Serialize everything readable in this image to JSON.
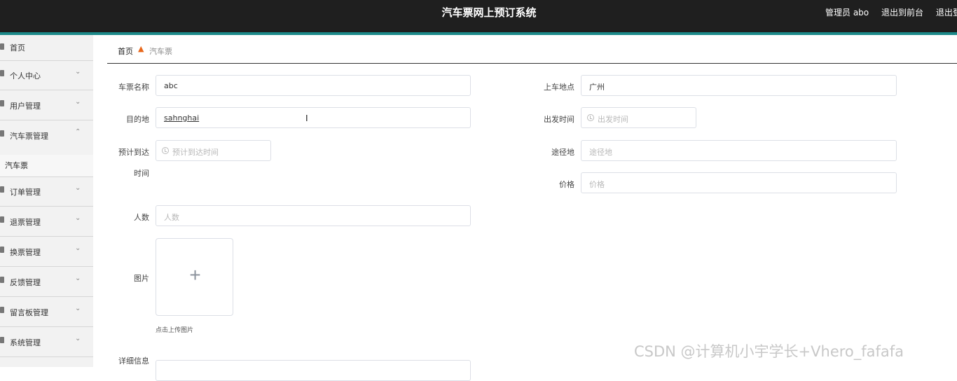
{
  "header": {
    "title": "汽车票网上预订系统",
    "admin": "管理员 abo",
    "to_front": "退出到前台",
    "logout": "退出登"
  },
  "sidebar": {
    "items": [
      {
        "label": "首页",
        "icon": "home-icon"
      },
      {
        "label": "个人中心",
        "icon": "person-icon"
      },
      {
        "label": "用户管理",
        "icon": "users-icon"
      },
      {
        "label": "汽车票管理",
        "icon": "ticket-icon"
      },
      {
        "label": "订单管理",
        "icon": "order-icon"
      },
      {
        "label": "退票管理",
        "icon": "refund-icon"
      },
      {
        "label": "换票管理",
        "icon": "exchange-icon"
      },
      {
        "label": "反馈管理",
        "icon": "feedback-icon"
      },
      {
        "label": "留言板管理",
        "icon": "message-icon"
      },
      {
        "label": "系统管理",
        "icon": "system-icon"
      }
    ],
    "sub_item": "汽车票",
    "chevron_down": "⌄",
    "chevron_up": "⌃"
  },
  "breadcrumb": {
    "home": "首页",
    "current": "汽车票"
  },
  "form": {
    "ticket_name": {
      "label": "车票名称",
      "value": "abc"
    },
    "boarding": {
      "label": "上车地点",
      "value": "广州"
    },
    "destination": {
      "label": "目的地",
      "value": "sahnghai"
    },
    "departure_time": {
      "label": "出发时间",
      "placeholder": "出发时间"
    },
    "arrival_time": {
      "label_line1": "预计到达",
      "label_line2": "时间",
      "placeholder": "预计到达时间"
    },
    "via": {
      "label": "途径地",
      "placeholder": "途径地"
    },
    "price": {
      "label": "价格",
      "placeholder": "价格"
    },
    "people": {
      "label": "人数",
      "placeholder": "人数"
    },
    "image": {
      "label": "图片",
      "upload_tip": "点击上传图片",
      "plus": "+"
    },
    "detail": {
      "label": "详细信息"
    }
  },
  "watermark": "CSDN @计算机小宇学长+Vhero_fafafa",
  "colors": {
    "topbar": "#1f1f1f",
    "accent": "#1d8a8a",
    "sidebar": "#f2f2f2"
  }
}
